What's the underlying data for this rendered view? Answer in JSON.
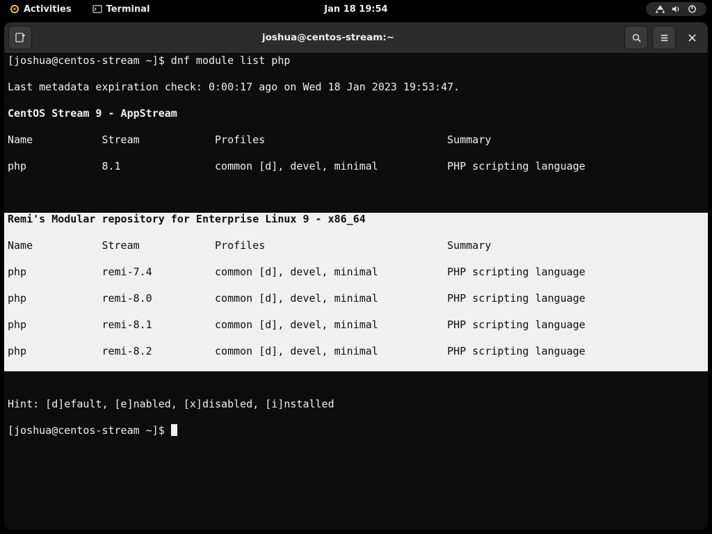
{
  "topbar": {
    "activities": "Activities",
    "terminal": "Terminal",
    "clock": "Jan 18  19:54"
  },
  "header": {
    "title": "joshua@centos-stream:~"
  },
  "term": {
    "prompt1": "[joshua@centos-stream ~]$ ",
    "cmd1": "dnf module list php",
    "meta": "Last metadata expiration check: 0:00:17 ago on Wed 18 Jan 2023 19:53:47.",
    "repo1_title": "CentOS Stream 9 - AppStream",
    "cols": {
      "name": "Name",
      "stream": "Stream",
      "profiles": "Profiles",
      "summary": "Summary"
    },
    "repo1_rows": [
      {
        "name": "php",
        "stream": "8.1",
        "profiles": "common [d], devel, minimal",
        "summary": "PHP scripting language"
      }
    ],
    "repo2_title": "Remi's Modular repository for Enterprise Linux 9 - x86_64",
    "repo2_rows": [
      {
        "name": "php",
        "stream": "remi-7.4",
        "profiles": "common [d], devel, minimal",
        "summary": "PHP scripting language"
      },
      {
        "name": "php",
        "stream": "remi-8.0",
        "profiles": "common [d], devel, minimal",
        "summary": "PHP scripting language"
      },
      {
        "name": "php",
        "stream": "remi-8.1",
        "profiles": "common [d], devel, minimal",
        "summary": "PHP scripting language"
      },
      {
        "name": "php",
        "stream": "remi-8.2",
        "profiles": "common [d], devel, minimal",
        "summary": "PHP scripting language"
      }
    ],
    "hint": "Hint: [d]efault, [e]nabled, [x]disabled, [i]nstalled",
    "prompt2": "[joshua@centos-stream ~]$ "
  },
  "layout": {
    "col_name": 15,
    "col_stream": 18,
    "col_profiles": 37
  }
}
